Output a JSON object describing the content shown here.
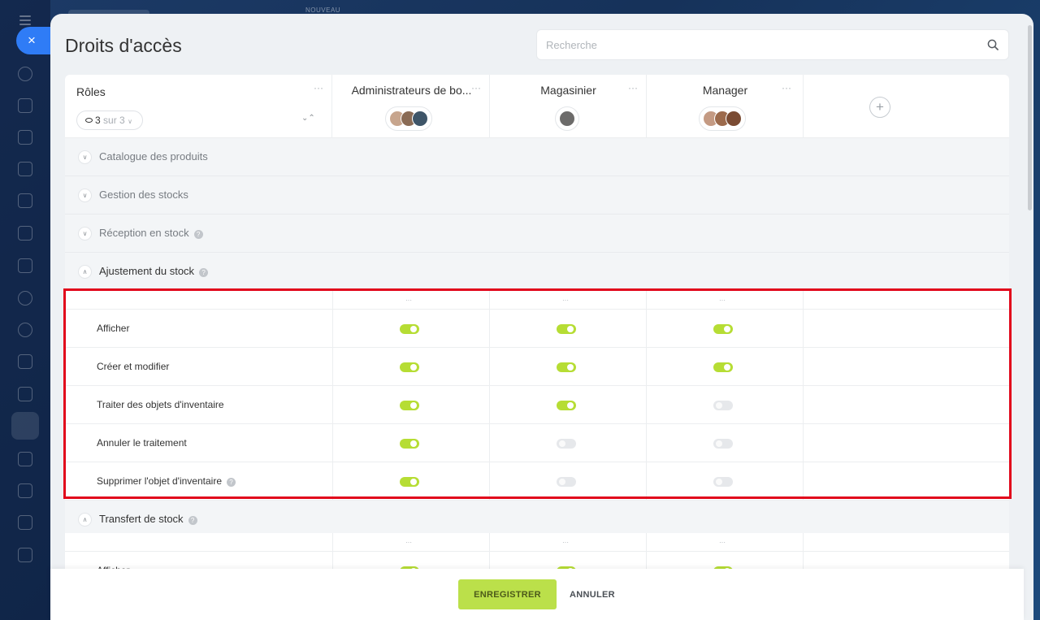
{
  "appbar": {
    "new_badge": "NOUVEAU",
    "close_glyph": "×"
  },
  "page": {
    "title": "Droits d'accès",
    "search_placeholder": "Recherche"
  },
  "roles": {
    "header": "Rôles",
    "filter": {
      "count": "3",
      "suffix": "sur 3"
    },
    "columns": [
      {
        "name": "Administrateurs de bo...",
        "avatars": 3
      },
      {
        "name": "Magasinier",
        "avatars": 1
      },
      {
        "name": "Manager",
        "avatars": 3
      }
    ],
    "add_glyph": "+"
  },
  "sections": {
    "catalogue": {
      "title": "Catalogue des produits",
      "expanded": false
    },
    "gestion": {
      "title": "Gestion des stocks",
      "expanded": false
    },
    "reception": {
      "title": "Réception en stock",
      "expanded": false
    },
    "ajustement": {
      "title": "Ajustement du stock",
      "expanded": true,
      "rows": [
        {
          "label": "Afficher",
          "values": [
            true,
            true,
            true
          ]
        },
        {
          "label": "Créer et modifier",
          "values": [
            true,
            true,
            true
          ]
        },
        {
          "label": "Traiter des objets d'inventaire",
          "values": [
            true,
            true,
            false
          ]
        },
        {
          "label": "Annuler le traitement",
          "values": [
            true,
            false,
            false
          ]
        },
        {
          "label": "Supprimer l'objet d'inventaire",
          "values": [
            true,
            false,
            false
          ]
        }
      ]
    },
    "transfert": {
      "title": "Transfert de stock",
      "expanded": true,
      "rows": [
        {
          "label": "Afficher",
          "values": [
            true,
            true,
            true
          ]
        }
      ]
    }
  },
  "footer": {
    "save_label": "ENREGISTRER",
    "cancel_label": "ANNULER"
  },
  "colors": {
    "toggle_on": "#b6dd34",
    "toggle_off": "#e6e8eb",
    "highlight": "#e1061b",
    "accent_blue": "#2f7cf6"
  }
}
